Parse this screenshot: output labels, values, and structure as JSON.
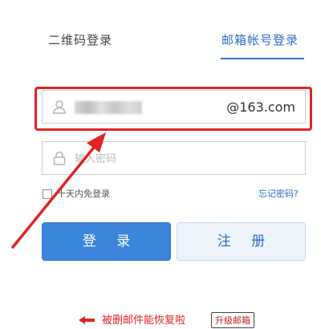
{
  "tabs": {
    "qr_label": "二维码登录",
    "email_label": "邮箱帐号登录"
  },
  "account": {
    "domain_suffix": "@163.com"
  },
  "password": {
    "placeholder": "输入密码"
  },
  "remember": {
    "label": "十天内免登录",
    "checked": false
  },
  "forgot": {
    "label": "忘记密码?"
  },
  "buttons": {
    "login_label": "登 录",
    "register_label": "注 册"
  },
  "promo": {
    "text": "被删邮件能恢复啦",
    "button_label": "升级邮箱"
  },
  "icons": {
    "user": "user-icon",
    "lock": "lock-icon"
  },
  "colors": {
    "accent_blue": "#3b86dc",
    "tab_active": "#2b6cc4",
    "annotation_red": "#e02424"
  }
}
